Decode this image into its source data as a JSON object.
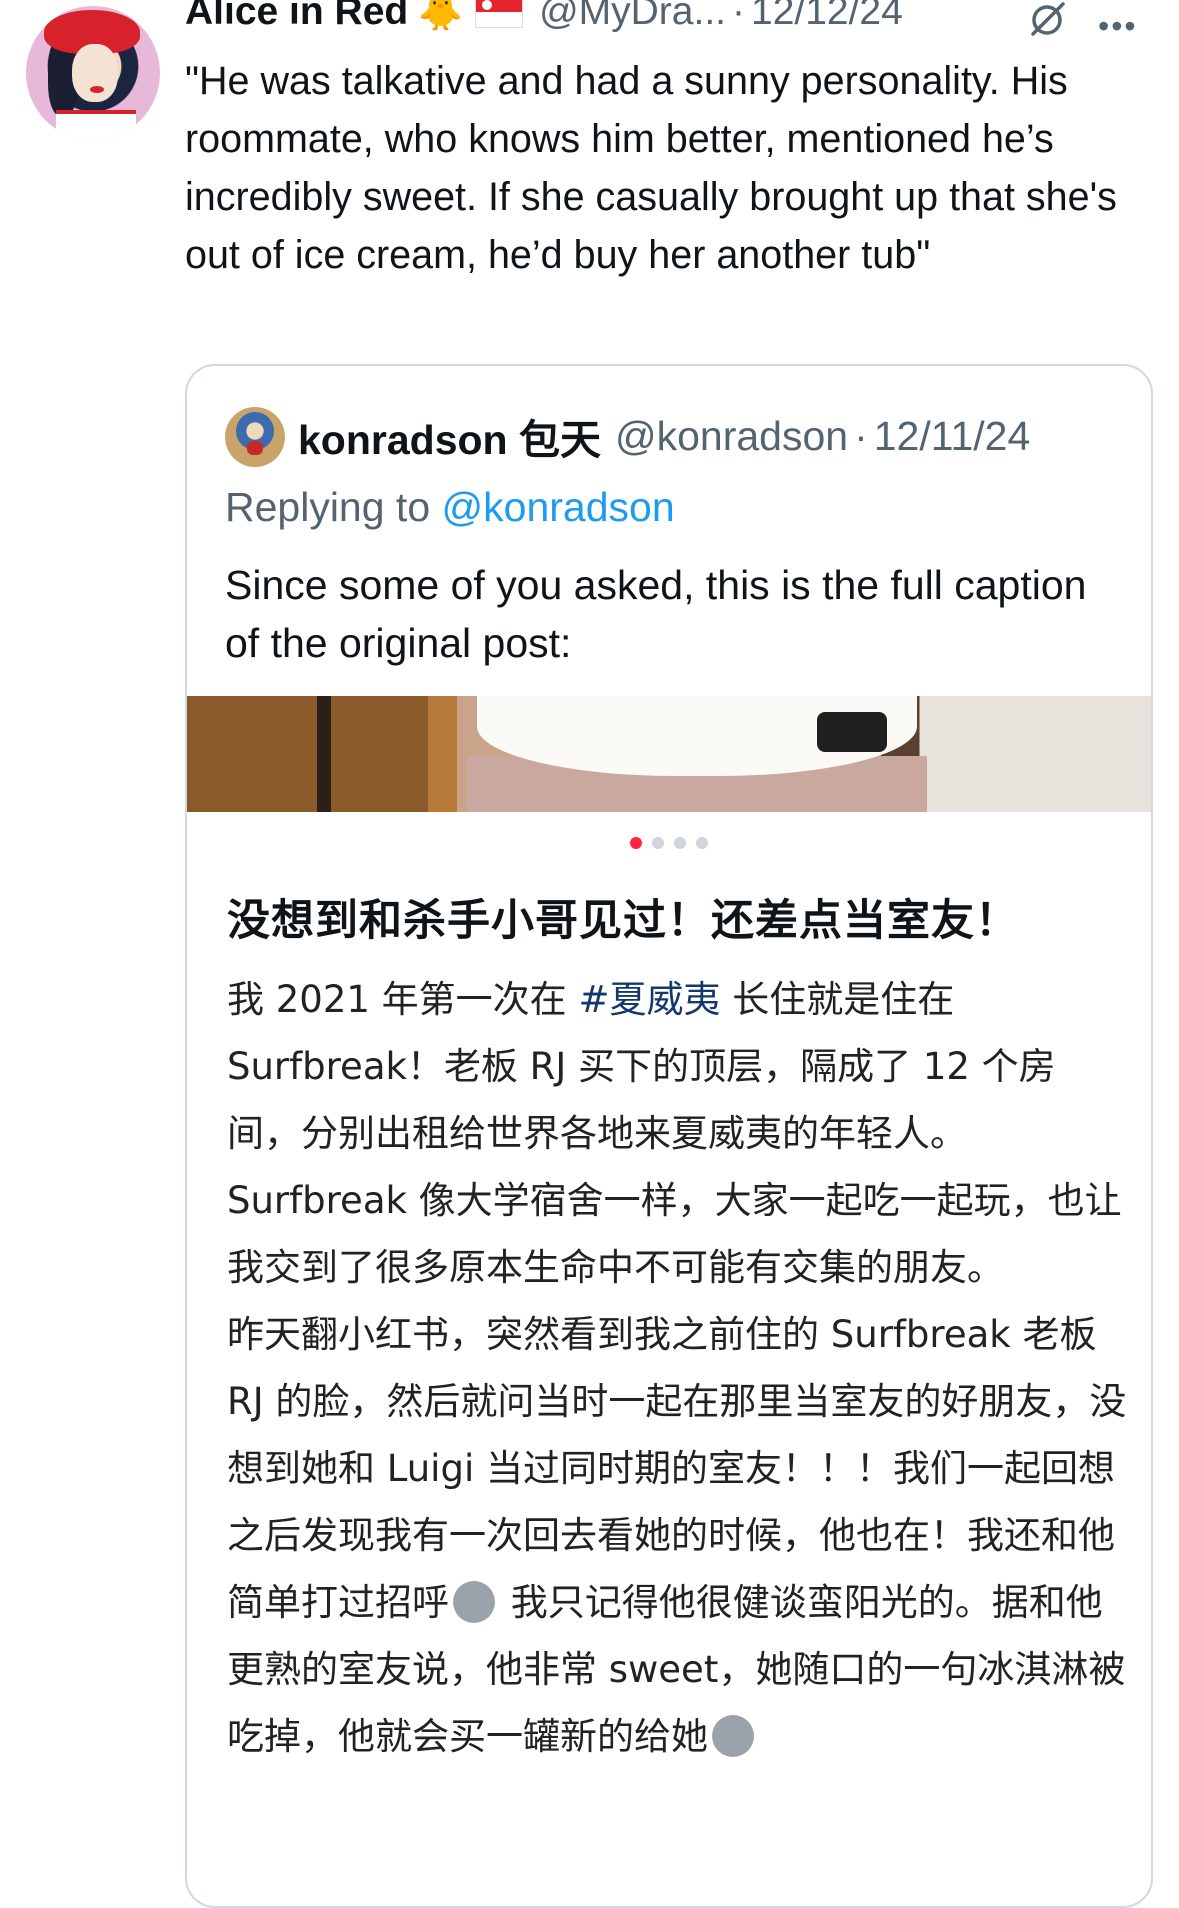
{
  "tweet": {
    "author_name": "Alice in Red",
    "emoji": "🐥",
    "handle": "@MyDra...",
    "separator": "·",
    "date": "12/12/24",
    "more_label": "•••",
    "text": "\"He was talkative and had a sunny personality. His roommate, who knows him better, mentioned he’s incredibly sweet. If she casually brought up that she's out of ice cream, he’d buy her another tub\""
  },
  "quote": {
    "author_name": "konradson 包天",
    "handle": "@konradson",
    "separator": "·",
    "date": "12/11/24",
    "replying_prefix": "Replying to",
    "replying_handle": "@konradson",
    "text": "Since some of you asked, this is the full caption of the original post:",
    "carousel": {
      "count": 4,
      "active_index": 0
    },
    "post_title": "没想到和杀手小哥见过！还差点当室友！",
    "post_body_part1": "我 2021 年第一次在 ",
    "post_hashtag": "#夏威夷",
    "post_body_part2": "  长住就是住在 Surfbreak！老板 RJ 买下的顶层，隔成了 12 个房间，分别出租给世界各地来夏威夷的年轻人。Surfbreak 像大学宿舍一样，大家一起吃一起玩，也让我交到了很多原本生命中不可能有交集的朋友。",
    "post_body_part3": "昨天翻小红书，突然看到我之前住的 Surfbreak 老板 RJ 的脸，然后就问当时一起在那里当室友的好朋友，没想到她和 Luigi 当过同时期的室友！！！我们一起回想之后发现我有一次回去看她的时候，他也在！我还和他简单打过招呼",
    "post_body_part4": " 我只记得他很健谈蛮阳光的。据和他更熟的室友说，他非常 sweet，她随口的一句冰淇淋被吃掉，他就会买一罐新的给她"
  }
}
